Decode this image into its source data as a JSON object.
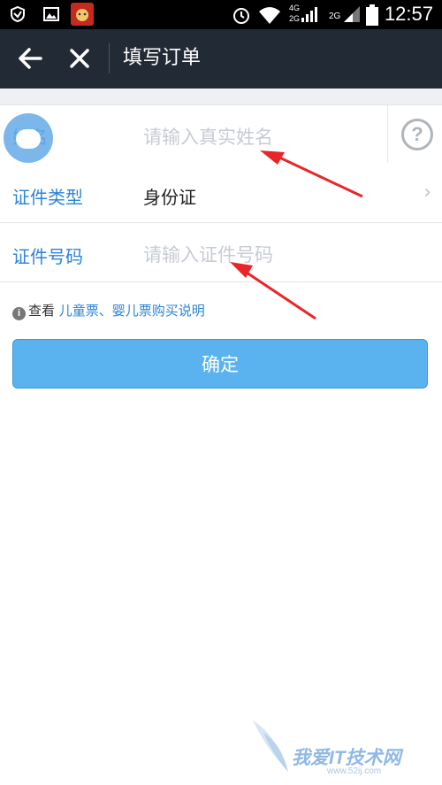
{
  "status_bar": {
    "time": "12:57",
    "network_labels": [
      "4G",
      "2G",
      "2G"
    ]
  },
  "header": {
    "title": "填写订单"
  },
  "form": {
    "name": {
      "label": "姓名",
      "placeholder": "请输入真实姓名"
    },
    "id_type": {
      "label": "证件类型",
      "value": "身份证"
    },
    "id_number": {
      "label": "证件号码",
      "placeholder": "请输入证件号码"
    }
  },
  "note": {
    "prefix": "查看",
    "link": "儿童票、婴儿票购买说明"
  },
  "confirm_button": {
    "label": "确定"
  },
  "watermark": {
    "text": "我爱IT技术网",
    "url": "www.52ij.com"
  },
  "colors": {
    "header_bg": "#222a36",
    "accent": "#2b84d6",
    "button": "#5ab3ee"
  }
}
